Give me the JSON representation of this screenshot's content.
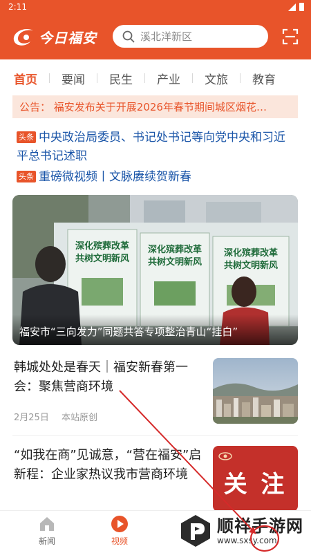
{
  "status": {
    "time": "2:11"
  },
  "header": {
    "logo_text": "今日福安",
    "search_placeholder": "溪北洋新区"
  },
  "tabs": [
    {
      "label": "首页",
      "active": true
    },
    {
      "label": "要闻"
    },
    {
      "label": "民生"
    },
    {
      "label": "产业"
    },
    {
      "label": "文旅"
    },
    {
      "label": "教育"
    }
  ],
  "notice": {
    "text": "公告：  福安发布关于开展2026年春节期间城区烟花…"
  },
  "headlines": [
    {
      "tag": "头条",
      "text": "中央政治局委员、书记处书记等向党中央和习近平总书记述职"
    },
    {
      "tag": "头条",
      "text": "重磅微视频丨文脉赓续贺新春"
    }
  ],
  "banner": {
    "caption": "福安市“三向发力”同题共答专项整治青山“挂白”",
    "board_text": "深化殡葬改革 共树文明新风"
  },
  "news": [
    {
      "title": "韩城处处是春天｜福安新春第一会：聚焦营商环境",
      "date": "2月25日",
      "source": "本站原创"
    },
    {
      "title": "“如我在商”见诚意，“营在福安”启新程：企业家热议我市营商环境",
      "thumb_text": "关 注"
    }
  ],
  "bottom_nav": [
    {
      "label": "新闻",
      "icon": "home-icon"
    },
    {
      "label": "视频",
      "icon": "play-icon",
      "active": true
    }
  ],
  "watermark": {
    "main": "顺祥手游网",
    "sub": "www.sxsy.com"
  },
  "colors": {
    "brand": "#e8542a",
    "link": "#1a55a8",
    "notice_bg": "#fbe6dc"
  }
}
